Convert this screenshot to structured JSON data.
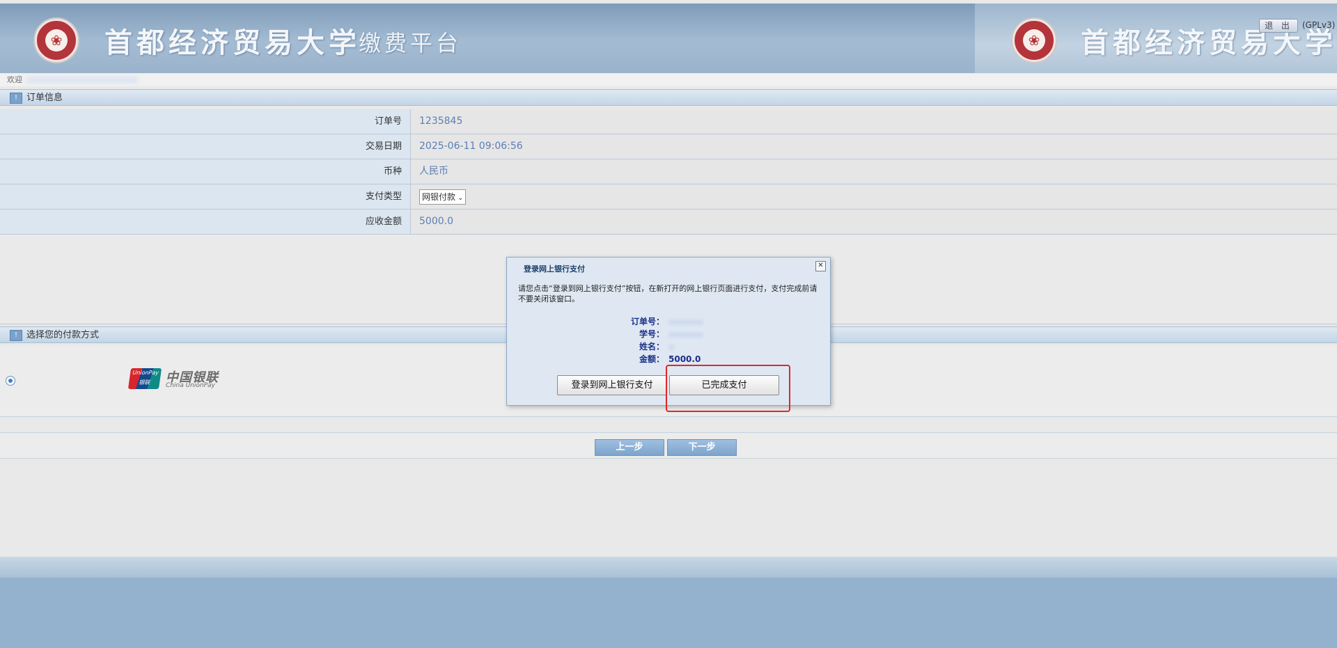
{
  "header": {
    "university": "首都经济贸易大学",
    "platform": "缴费平台",
    "logout_label": "退 出",
    "license": "(GPLv3)"
  },
  "welcome": {
    "label": "欢迎"
  },
  "order_section": {
    "title": "订单信息",
    "rows": [
      {
        "label": "订单号",
        "value": "1235845"
      },
      {
        "label": "交易日期",
        "value": "2025-06-11 09:06:56"
      },
      {
        "label": "币种",
        "value": "人民币"
      },
      {
        "label": "支付类型",
        "value": "网银付款"
      },
      {
        "label": "应收金额",
        "value": "5000.0"
      }
    ]
  },
  "payment_section": {
    "title": "选择您的付款方式",
    "unionpay_cn": "中国银联",
    "unionpay_en": "China UnionPay",
    "unionpay_card_top": "UnionPay",
    "unionpay_card_bottom": "银联"
  },
  "nav": {
    "prev_label": "上一步",
    "next_label": "下一步"
  },
  "dialog": {
    "title": "登录网上银行支付",
    "close_symbol": "✕",
    "message": "请您点击“登录到网上银行支付”按钮，在新打开的网上银行页面进行支付，支付完成前请不要关闭该窗口。",
    "fields": [
      {
        "label": "订单号：",
        "value": ""
      },
      {
        "label": "学号：",
        "value": ""
      },
      {
        "label": "姓名：",
        "value": ""
      },
      {
        "label": "金额：",
        "value": "5000.0"
      }
    ],
    "login_button": "登录到网上银行支付",
    "done_button": "已完成支付"
  }
}
